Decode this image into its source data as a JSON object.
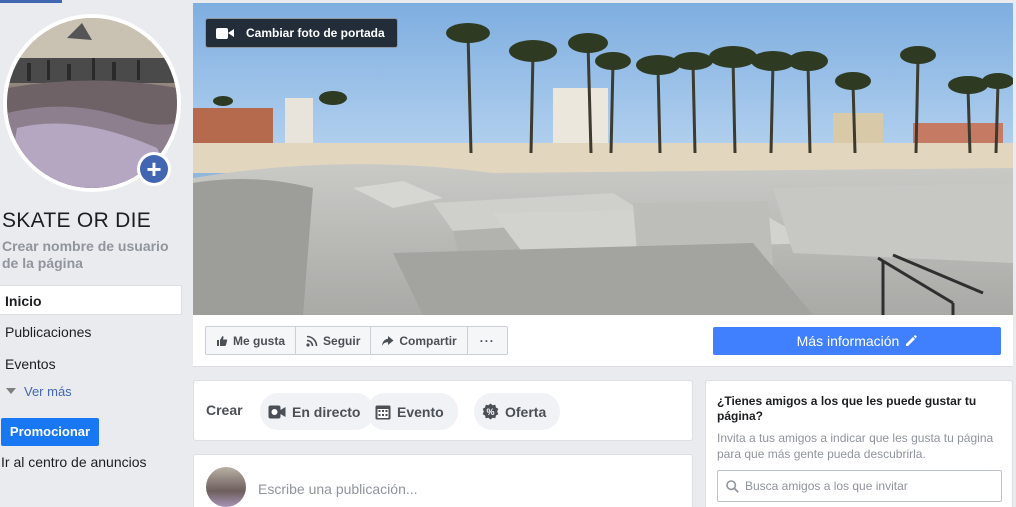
{
  "sidebar": {
    "page_name": "SKATE OR DIE",
    "username_prompt": "Crear nombre de usuario de la página",
    "nav": [
      {
        "label": "Inicio"
      },
      {
        "label": "Publicaciones"
      },
      {
        "label": "Eventos"
      }
    ],
    "see_more": "Ver más",
    "promote": "Promocionar",
    "ads_center": "Ir al centro de anuncios"
  },
  "cover": {
    "change_cover_label": "Cambiar foto de portada"
  },
  "actions": {
    "like": "Me gusta",
    "follow": "Seguir",
    "share": "Compartir",
    "more": "···",
    "more_info": "Más información"
  },
  "create": {
    "label": "Crear",
    "options": [
      {
        "label": "En directo"
      },
      {
        "label": "Evento"
      },
      {
        "label": "Oferta"
      }
    ]
  },
  "composer": {
    "placeholder": "Escribe una publicación..."
  },
  "invite": {
    "title": "¿Tienes amigos a los que les puede gustar tu página?",
    "description": "Invita a tus amigos a indicar que les gusta tu página para que más gente pueda descubrirla.",
    "search_placeholder": "Busca amigos a los que invitar"
  },
  "colors": {
    "primary": "#4267b2",
    "more_info_button": "#4080ff",
    "promote_button": "#1877f2",
    "background": "#e9ebee"
  }
}
